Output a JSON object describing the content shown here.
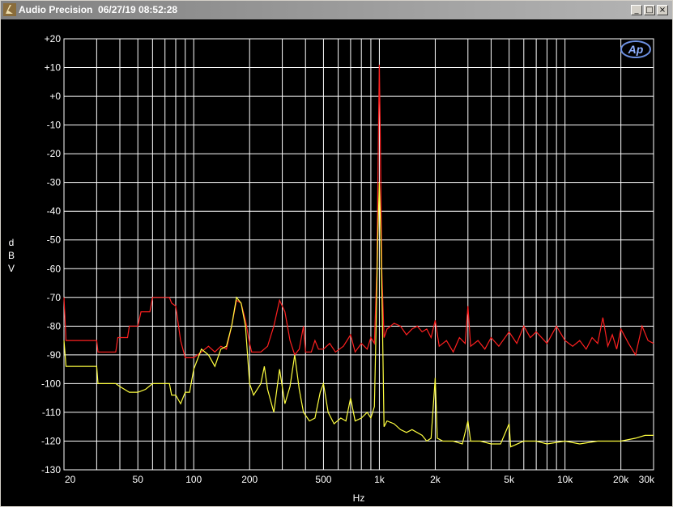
{
  "window": {
    "title": "Audio Precision  06/27/19 08:52:28"
  },
  "titlebar_buttons": [
    "_",
    "□",
    "×"
  ],
  "logo_text": "Ap",
  "colors": {
    "background": "#000000",
    "grid": "#ffffff",
    "series_red": "#ff2020",
    "series_yellow": "#ffff40"
  },
  "chart_data": {
    "type": "line",
    "title": "",
    "xlabel": "Hz",
    "ylabel": [
      "d",
      "B",
      "V"
    ],
    "xscale": "log",
    "xlim": [
      20,
      30000
    ],
    "ylim": [
      -130,
      20
    ],
    "grid": true,
    "y_ticks": [
      {
        "v": 20,
        "label": "+20"
      },
      {
        "v": 10,
        "label": "+10"
      },
      {
        "v": 0,
        "label": "+0"
      },
      {
        "v": -10,
        "label": "-10"
      },
      {
        "v": -20,
        "label": "-20"
      },
      {
        "v": -30,
        "label": "-30"
      },
      {
        "v": -40,
        "label": "-40"
      },
      {
        "v": -50,
        "label": "-50"
      },
      {
        "v": -60,
        "label": "-60"
      },
      {
        "v": -70,
        "label": "-70"
      },
      {
        "v": -80,
        "label": "-80"
      },
      {
        "v": -90,
        "label": "-90"
      },
      {
        "v": -100,
        "label": "-100"
      },
      {
        "v": -110,
        "label": "-110"
      },
      {
        "v": -120,
        "label": "-120"
      },
      {
        "v": -130,
        "label": "-130"
      }
    ],
    "x_ticks": [
      {
        "v": 20,
        "label": "20"
      },
      {
        "v": 50,
        "label": "50"
      },
      {
        "v": 100,
        "label": "100"
      },
      {
        "v": 200,
        "label": "200"
      },
      {
        "v": 500,
        "label": "500"
      },
      {
        "v": 1000,
        "label": "1k"
      },
      {
        "v": 2000,
        "label": "2k"
      },
      {
        "v": 5000,
        "label": "5k"
      },
      {
        "v": 10000,
        "label": "10k"
      },
      {
        "v": 20000,
        "label": "20k"
      },
      {
        "v": 30000,
        "label": "30k"
      }
    ],
    "series": [
      {
        "color": "#ff2020",
        "points": [
          [
            20,
            -70
          ],
          [
            20.5,
            -85
          ],
          [
            30,
            -85
          ],
          [
            30.5,
            -89
          ],
          [
            38,
            -89
          ],
          [
            39,
            -84
          ],
          [
            44,
            -84
          ],
          [
            45,
            -80
          ],
          [
            50,
            -80
          ],
          [
            52,
            -75
          ],
          [
            58,
            -75
          ],
          [
            60,
            -70
          ],
          [
            74,
            -70
          ],
          [
            76,
            -72
          ],
          [
            80,
            -73
          ],
          [
            85,
            -85
          ],
          [
            90,
            -91
          ],
          [
            100,
            -91
          ],
          [
            110,
            -89
          ],
          [
            120,
            -87
          ],
          [
            130,
            -89
          ],
          [
            140,
            -87
          ],
          [
            150,
            -88
          ],
          [
            160,
            -80
          ],
          [
            170,
            -71
          ],
          [
            180,
            -72
          ],
          [
            190,
            -78
          ],
          [
            200,
            -86
          ],
          [
            205,
            -89
          ],
          [
            230,
            -89
          ],
          [
            250,
            -87
          ],
          [
            270,
            -80
          ],
          [
            290,
            -71
          ],
          [
            310,
            -75
          ],
          [
            330,
            -85
          ],
          [
            350,
            -90
          ],
          [
            370,
            -88
          ],
          [
            390,
            -80
          ],
          [
            400,
            -89
          ],
          [
            430,
            -89
          ],
          [
            450,
            -85
          ],
          [
            470,
            -88
          ],
          [
            500,
            -88
          ],
          [
            540,
            -86
          ],
          [
            580,
            -89
          ],
          [
            640,
            -87
          ],
          [
            700,
            -83
          ],
          [
            740,
            -89
          ],
          [
            800,
            -86
          ],
          [
            860,
            -88
          ],
          [
            900,
            -84
          ],
          [
            940,
            -86
          ],
          [
            970,
            -60
          ],
          [
            990,
            -10
          ],
          [
            1000,
            11
          ],
          [
            1010,
            -10
          ],
          [
            1030,
            -60
          ],
          [
            1060,
            -84
          ],
          [
            1100,
            -81
          ],
          [
            1200,
            -79
          ],
          [
            1300,
            -80
          ],
          [
            1400,
            -83
          ],
          [
            1500,
            -81
          ],
          [
            1600,
            -80
          ],
          [
            1700,
            -82
          ],
          [
            1800,
            -81
          ],
          [
            1900,
            -84
          ],
          [
            2000,
            -78
          ],
          [
            2100,
            -87
          ],
          [
            2300,
            -85
          ],
          [
            2500,
            -89
          ],
          [
            2700,
            -84
          ],
          [
            2900,
            -86
          ],
          [
            3000,
            -73
          ],
          [
            3100,
            -87
          ],
          [
            3400,
            -85
          ],
          [
            3700,
            -88
          ],
          [
            4000,
            -84
          ],
          [
            4400,
            -87
          ],
          [
            5000,
            -82
          ],
          [
            5500,
            -86
          ],
          [
            6000,
            -80
          ],
          [
            6500,
            -84
          ],
          [
            7000,
            -82
          ],
          [
            8000,
            -86
          ],
          [
            9000,
            -80
          ],
          [
            10000,
            -85
          ],
          [
            11000,
            -87
          ],
          [
            12000,
            -85
          ],
          [
            13000,
            -88
          ],
          [
            14000,
            -84
          ],
          [
            15000,
            -86
          ],
          [
            16000,
            -77
          ],
          [
            17000,
            -87
          ],
          [
            18000,
            -83
          ],
          [
            19000,
            -88
          ],
          [
            20000,
            -81
          ],
          [
            22000,
            -86
          ],
          [
            24000,
            -90
          ],
          [
            26000,
            -80
          ],
          [
            28000,
            -85
          ],
          [
            30000,
            -86
          ]
        ]
      },
      {
        "color": "#ffff40",
        "points": [
          [
            20,
            -85
          ],
          [
            20.5,
            -94
          ],
          [
            30,
            -94
          ],
          [
            30.5,
            -100
          ],
          [
            38,
            -100
          ],
          [
            40,
            -101
          ],
          [
            45,
            -103
          ],
          [
            50,
            -103
          ],
          [
            55,
            -102
          ],
          [
            60,
            -100
          ],
          [
            74,
            -100
          ],
          [
            76,
            -104
          ],
          [
            80,
            -104
          ],
          [
            85,
            -107
          ],
          [
            90,
            -103
          ],
          [
            95,
            -103
          ],
          [
            100,
            -95
          ],
          [
            110,
            -88
          ],
          [
            120,
            -90
          ],
          [
            130,
            -94
          ],
          [
            140,
            -88
          ],
          [
            150,
            -87
          ],
          [
            160,
            -80
          ],
          [
            170,
            -70
          ],
          [
            180,
            -72
          ],
          [
            190,
            -80
          ],
          [
            200,
            -100
          ],
          [
            210,
            -104
          ],
          [
            230,
            -100
          ],
          [
            240,
            -94
          ],
          [
            250,
            -102
          ],
          [
            270,
            -110
          ],
          [
            290,
            -95
          ],
          [
            310,
            -107
          ],
          [
            330,
            -101
          ],
          [
            350,
            -90
          ],
          [
            370,
            -102
          ],
          [
            390,
            -110
          ],
          [
            420,
            -113
          ],
          [
            450,
            -112
          ],
          [
            480,
            -103
          ],
          [
            500,
            -100
          ],
          [
            530,
            -110
          ],
          [
            570,
            -114
          ],
          [
            620,
            -112
          ],
          [
            660,
            -113
          ],
          [
            700,
            -105
          ],
          [
            740,
            -113
          ],
          [
            800,
            -112
          ],
          [
            860,
            -110
          ],
          [
            900,
            -112
          ],
          [
            940,
            -108
          ],
          [
            960,
            -80
          ],
          [
            980,
            -50
          ],
          [
            1000,
            -30
          ],
          [
            1020,
            -50
          ],
          [
            1040,
            -80
          ],
          [
            1060,
            -115
          ],
          [
            1100,
            -113
          ],
          [
            1200,
            -114
          ],
          [
            1300,
            -116
          ],
          [
            1400,
            -117
          ],
          [
            1500,
            -116
          ],
          [
            1700,
            -118
          ],
          [
            1800,
            -120
          ],
          [
            1900,
            -119
          ],
          [
            2000,
            -98
          ],
          [
            2050,
            -119
          ],
          [
            2200,
            -120
          ],
          [
            2500,
            -120
          ],
          [
            2800,
            -121
          ],
          [
            3000,
            -113
          ],
          [
            3100,
            -120
          ],
          [
            3500,
            -120
          ],
          [
            4000,
            -121
          ],
          [
            4500,
            -121
          ],
          [
            5000,
            -114
          ],
          [
            5100,
            -122
          ],
          [
            6000,
            -120
          ],
          [
            7000,
            -120
          ],
          [
            8000,
            -121
          ],
          [
            10000,
            -120
          ],
          [
            12000,
            -121
          ],
          [
            15000,
            -120
          ],
          [
            18000,
            -120
          ],
          [
            20000,
            -120
          ],
          [
            24000,
            -119
          ],
          [
            27000,
            -118
          ],
          [
            30000,
            -118
          ]
        ]
      }
    ]
  }
}
